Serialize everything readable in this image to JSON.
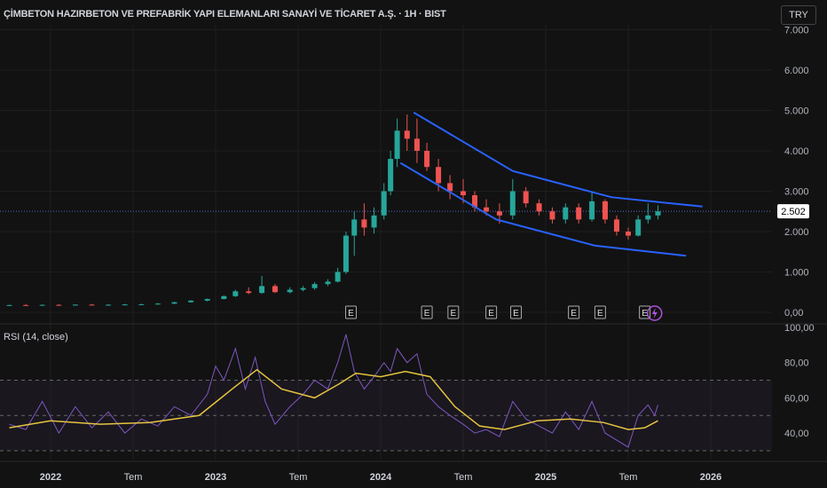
{
  "header": {
    "title": "ÇİMBETON HAZIRBETON VE PREFABRİK YAPI ELEMANLARI SANAYİ VE TİCARET A.Ş. · 1H · BIST",
    "currency": "TRY"
  },
  "rsi_label": "RSI (14, close)",
  "colors": {
    "up": "#26a69a",
    "down": "#ef5350",
    "channel": "#2962ff",
    "rsi": "#7e57c2",
    "rsi_ma": "#e6c440",
    "bg": "#121212"
  },
  "chart_data": [
    {
      "type": "candlestick",
      "title": "ÇİMBETON · 1H · BIST",
      "ylim": [
        0,
        7000
      ],
      "y_ticks": [
        "7.000",
        "6.000",
        "5.000",
        "4.000",
        "3.000",
        "2.000",
        "1.000",
        "0,00"
      ],
      "y_tick_values": [
        7000,
        6000,
        5000,
        4000,
        3000,
        2000,
        1000,
        0
      ],
      "x_ticks": [
        {
          "t": 2022,
          "label": "2022"
        },
        {
          "t": 2022.5,
          "label": "Tem"
        },
        {
          "t": 2023,
          "label": "2023"
        },
        {
          "t": 2023.5,
          "label": "Tem"
        },
        {
          "t": 2024,
          "label": "2024"
        },
        {
          "t": 2024.5,
          "label": "Tem"
        },
        {
          "t": 2025,
          "label": "2025"
        },
        {
          "t": 2025.5,
          "label": "Tem"
        },
        {
          "t": 2026,
          "label": "2026"
        }
      ],
      "last_price": 2502,
      "last_price_label": "2.502",
      "candles": [
        [
          2021.75,
          170,
          190,
          160,
          180
        ],
        [
          2021.85,
          180,
          200,
          170,
          175
        ],
        [
          2021.95,
          175,
          195,
          165,
          185
        ],
        [
          2022.05,
          185,
          200,
          170,
          178
        ],
        [
          2022.15,
          178,
          195,
          165,
          190
        ],
        [
          2022.25,
          190,
          205,
          175,
          180
        ],
        [
          2022.35,
          180,
          200,
          170,
          188
        ],
        [
          2022.45,
          188,
          210,
          180,
          195
        ],
        [
          2022.55,
          195,
          215,
          185,
          200
        ],
        [
          2022.65,
          200,
          230,
          190,
          215
        ],
        [
          2022.75,
          215,
          260,
          200,
          250
        ],
        [
          2022.85,
          250,
          300,
          240,
          290
        ],
        [
          2022.95,
          290,
          340,
          270,
          330
        ],
        [
          2023.05,
          330,
          420,
          320,
          400
        ],
        [
          2023.12,
          400,
          560,
          380,
          520
        ],
        [
          2023.2,
          520,
          620,
          450,
          480
        ],
        [
          2023.28,
          480,
          900,
          460,
          650
        ],
        [
          2023.36,
          650,
          700,
          480,
          500
        ],
        [
          2023.45,
          500,
          620,
          470,
          560
        ],
        [
          2023.53,
          560,
          650,
          520,
          600
        ],
        [
          2023.6,
          600,
          750,
          560,
          700
        ],
        [
          2023.68,
          700,
          820,
          650,
          760
        ],
        [
          2023.74,
          760,
          1100,
          740,
          1000
        ],
        [
          2023.79,
          1000,
          2000,
          950,
          1900
        ],
        [
          2023.84,
          1900,
          2500,
          1400,
          2300
        ],
        [
          2023.9,
          2300,
          2700,
          1900,
          2100
        ],
        [
          2023.96,
          2100,
          2600,
          1950,
          2400
        ],
        [
          2024.02,
          2400,
          3200,
          2300,
          3000
        ],
        [
          2024.06,
          3000,
          4000,
          2900,
          3800
        ],
        [
          2024.1,
          3800,
          4800,
          3600,
          4500
        ],
        [
          2024.16,
          4500,
          4900,
          4000,
          4300
        ],
        [
          2024.22,
          4300,
          4800,
          3700,
          4000
        ],
        [
          2024.28,
          4000,
          4200,
          3500,
          3600
        ],
        [
          2024.35,
          3600,
          3800,
          3000,
          3200
        ],
        [
          2024.42,
          3200,
          3400,
          2800,
          3000
        ],
        [
          2024.5,
          3000,
          3300,
          2700,
          2900
        ],
        [
          2024.57,
          2900,
          3000,
          2500,
          2600
        ],
        [
          2024.64,
          2600,
          2800,
          2400,
          2500
        ],
        [
          2024.72,
          2500,
          2700,
          2200,
          2400
        ],
        [
          2024.8,
          2400,
          3300,
          2300,
          3000
        ],
        [
          2024.88,
          3000,
          3100,
          2600,
          2700
        ],
        [
          2024.96,
          2700,
          2800,
          2400,
          2500
        ],
        [
          2025.04,
          2500,
          2600,
          2200,
          2300
        ],
        [
          2025.12,
          2300,
          2700,
          2200,
          2600
        ],
        [
          2025.2,
          2600,
          2700,
          2200,
          2300
        ],
        [
          2025.28,
          2300,
          3000,
          2250,
          2750
        ],
        [
          2025.36,
          2750,
          2800,
          2200,
          2300
        ],
        [
          2025.43,
          2300,
          2400,
          1900,
          2000
        ],
        [
          2025.5,
          2000,
          2100,
          1800,
          1900
        ],
        [
          2025.56,
          1900,
          2400,
          1880,
          2300
        ],
        [
          2025.62,
          2300,
          2700,
          2200,
          2400
        ],
        [
          2025.68,
          2400,
          2650,
          2300,
          2502
        ]
      ],
      "channel_upper": [
        [
          2024.2,
          4950
        ],
        [
          2024.8,
          3500
        ],
        [
          2025.4,
          2850
        ],
        [
          2025.95,
          2620
        ]
      ],
      "channel_lower": [
        [
          2024.12,
          3700
        ],
        [
          2024.7,
          2300
        ],
        [
          2025.3,
          1650
        ],
        [
          2025.85,
          1400
        ]
      ],
      "event_markers": [
        {
          "t": 2023.82,
          "label": "E"
        },
        {
          "t": 2024.28,
          "label": "E"
        },
        {
          "t": 2024.44,
          "label": "E"
        },
        {
          "t": 2024.67,
          "label": "E"
        },
        {
          "t": 2024.82,
          "label": "E"
        },
        {
          "t": 2025.17,
          "label": "E"
        },
        {
          "t": 2025.33,
          "label": "E"
        },
        {
          "t": 2025.6,
          "label": "E"
        }
      ],
      "lightning_marker_t": 2025.66
    },
    {
      "type": "line",
      "title": "RSI (14, close)",
      "ylim": [
        25,
        100
      ],
      "y_ticks": [
        "100,00",
        "80,00",
        "60,00",
        "40,00"
      ],
      "y_tick_values": [
        100,
        80,
        60,
        40
      ],
      "bands": [
        30,
        50,
        70
      ],
      "series": [
        {
          "name": "RSI",
          "values": [
            [
              2021.75,
              45
            ],
            [
              2021.85,
              42
            ],
            [
              2021.95,
              58
            ],
            [
              2022.05,
              40
            ],
            [
              2022.15,
              55
            ],
            [
              2022.25,
              43
            ],
            [
              2022.35,
              52
            ],
            [
              2022.45,
              40
            ],
            [
              2022.55,
              48
            ],
            [
              2022.65,
              44
            ],
            [
              2022.75,
              55
            ],
            [
              2022.85,
              50
            ],
            [
              2022.95,
              62
            ],
            [
              2023.0,
              78
            ],
            [
              2023.05,
              70
            ],
            [
              2023.12,
              88
            ],
            [
              2023.18,
              65
            ],
            [
              2023.24,
              83
            ],
            [
              2023.3,
              58
            ],
            [
              2023.36,
              45
            ],
            [
              2023.45,
              55
            ],
            [
              2023.53,
              62
            ],
            [
              2023.6,
              70
            ],
            [
              2023.68,
              65
            ],
            [
              2023.74,
              80
            ],
            [
              2023.79,
              96
            ],
            [
              2023.84,
              75
            ],
            [
              2023.9,
              65
            ],
            [
              2023.96,
              72
            ],
            [
              2024.02,
              80
            ],
            [
              2024.06,
              75
            ],
            [
              2024.1,
              88
            ],
            [
              2024.16,
              80
            ],
            [
              2024.22,
              85
            ],
            [
              2024.28,
              62
            ],
            [
              2024.35,
              55
            ],
            [
              2024.42,
              50
            ],
            [
              2024.5,
              45
            ],
            [
              2024.57,
              40
            ],
            [
              2024.64,
              42
            ],
            [
              2024.72,
              38
            ],
            [
              2024.8,
              58
            ],
            [
              2024.88,
              48
            ],
            [
              2024.96,
              44
            ],
            [
              2025.04,
              40
            ],
            [
              2025.12,
              52
            ],
            [
              2025.2,
              42
            ],
            [
              2025.28,
              58
            ],
            [
              2025.36,
              40
            ],
            [
              2025.43,
              36
            ],
            [
              2025.5,
              32
            ],
            [
              2025.56,
              50
            ],
            [
              2025.62,
              56
            ],
            [
              2025.66,
              50
            ],
            [
              2025.68,
              56
            ]
          ]
        },
        {
          "name": "RSI MA",
          "values": [
            [
              2021.75,
              43
            ],
            [
              2022.0,
              47
            ],
            [
              2022.3,
              45
            ],
            [
              2022.6,
              46
            ],
            [
              2022.9,
              50
            ],
            [
              2023.1,
              65
            ],
            [
              2023.25,
              76
            ],
            [
              2023.4,
              65
            ],
            [
              2023.6,
              60
            ],
            [
              2023.75,
              68
            ],
            [
              2023.85,
              74
            ],
            [
              2024.0,
              72
            ],
            [
              2024.15,
              75
            ],
            [
              2024.3,
              72
            ],
            [
              2024.45,
              55
            ],
            [
              2024.6,
              44
            ],
            [
              2024.75,
              42
            ],
            [
              2024.95,
              47
            ],
            [
              2025.15,
              48
            ],
            [
              2025.35,
              46
            ],
            [
              2025.5,
              42
            ],
            [
              2025.6,
              43
            ],
            [
              2025.68,
              47
            ]
          ]
        }
      ]
    }
  ]
}
